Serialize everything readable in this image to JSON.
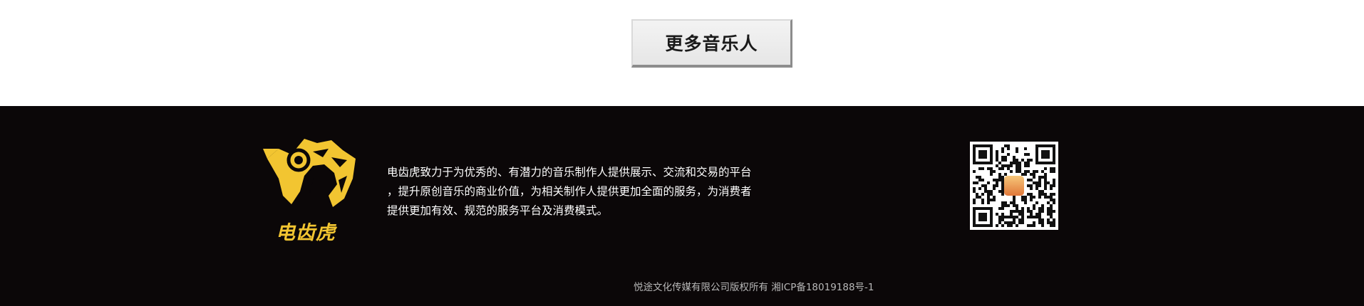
{
  "more_button": {
    "label": "更多音乐人"
  },
  "brand": {
    "name": "电齿虎",
    "logo_icon": "tiger-headphones-icon",
    "accent_color": "#f2c531"
  },
  "footer": {
    "description_lines": [
      "电齿虎致力于为优秀的、有潜力的音乐制作人提供展示、交流和交易的平台",
      "，提升原创音乐的商业价值，为相关制作人提供更加全面的服务，为消费者",
      "提供更加有效、规范的服务平台及消费模式。"
    ],
    "copyright": "悦途文化传媒有限公司版权所有 湘ICP备18019188号-1",
    "qr_icon": "qr-code-icon",
    "background_color": "#0b0708"
  }
}
